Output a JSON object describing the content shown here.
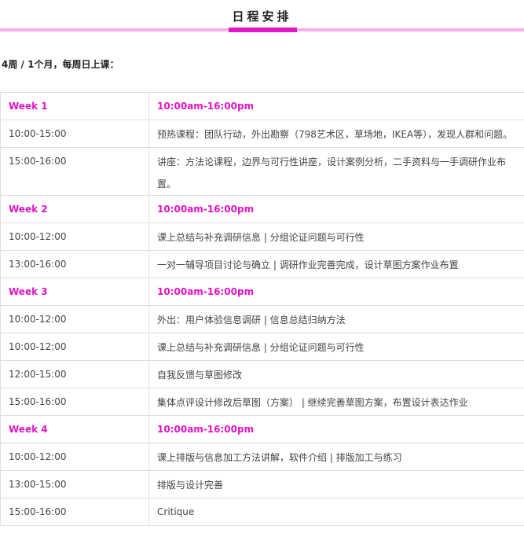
{
  "header": {
    "title": "日程安排"
  },
  "intro": "4周 / 1个月，每周日上课：",
  "schedule": [
    {
      "type": "week",
      "col1": "Week 1",
      "col2": "10:00am-16:00pm"
    },
    {
      "type": "row",
      "col1": "10:00-15:00",
      "col2": "预热课程：团队行动，外出勘察（798艺术区，草场地，IKEA等），发现人群和问题。"
    },
    {
      "type": "row",
      "col1": "15:00-16:00",
      "col2": "讲座：方法论课程，边界与可行性讲座，设计案例分析，二手资料与一手调研作业布置。",
      "tall": true
    },
    {
      "type": "week",
      "col1": "Week 2",
      "col2": "10:00am-16:00pm"
    },
    {
      "type": "row",
      "col1": "10:00-12:00",
      "col2": "课上总结与补充调研信息 | 分组论证问题与可行性"
    },
    {
      "type": "row",
      "col1": "13:00-16:00",
      "col2": "一对一辅导项目讨论与确立 | 调研作业完善完成，设计草图方案作业布置"
    },
    {
      "type": "week",
      "col1": "Week 3",
      "col2": "10:00am-16:00pm"
    },
    {
      "type": "row",
      "col1": "10:00-12:00",
      "col2": "外出：用户体验信息调研 | 信息总结归纳方法"
    },
    {
      "type": "row",
      "col1": "10:00-12:00",
      "col2": "课上总结与补充调研信息 | 分组论证问题与可行性"
    },
    {
      "type": "row",
      "col1": "12:00-15:00",
      "col2": "自我反馈与草图修改"
    },
    {
      "type": "row",
      "col1": "15:00-16:00",
      "col2": "集体点评设计修改后草图（方案） | 继续完善草图方案，布置设计表达作业"
    },
    {
      "type": "week",
      "col1": "Week 4",
      "col2": "10:00am-16:00pm"
    },
    {
      "type": "row",
      "col1": "10:00-12:00",
      "col2": "课上排版与信息加工方法讲解，软件介绍 | 排版加工与练习"
    },
    {
      "type": "row",
      "col1": "13:00-15:00",
      "col2": "排版与设计完善"
    },
    {
      "type": "row",
      "col1": "15:00-16:00",
      "col2": "Critique"
    }
  ]
}
